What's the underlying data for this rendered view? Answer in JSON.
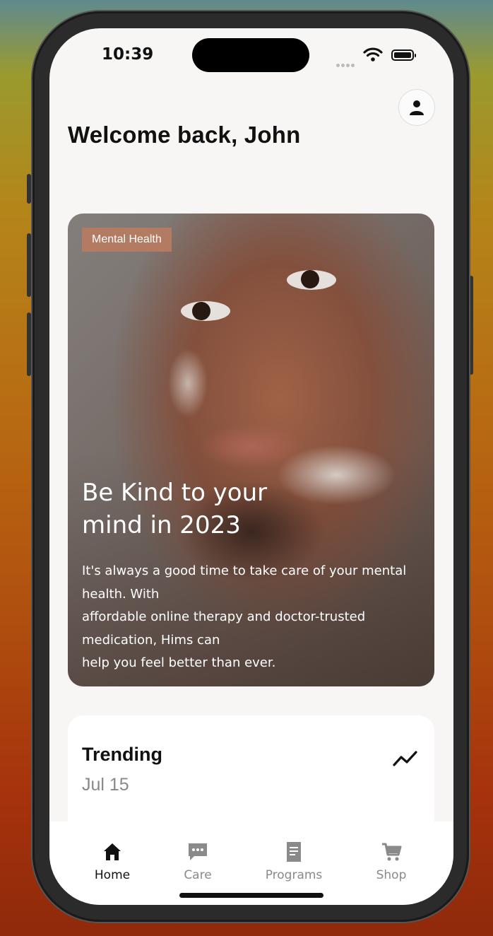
{
  "status_bar": {
    "time": "10:39"
  },
  "header": {
    "welcome": "Welcome back, John"
  },
  "hero": {
    "tag": "Mental Health",
    "title": "Be Kind to your\nmind in 2023",
    "body": "It's always a good time to take care of your mental\nhealth. With\n affordable online therapy and doctor-trusted\nmedication, Hims can\n help you feel better than ever."
  },
  "trending": {
    "title": "Trending",
    "date": "Jul 15"
  },
  "tabs": [
    {
      "label": "Home",
      "icon": "home-icon",
      "active": true
    },
    {
      "label": "Care",
      "icon": "chat-icon",
      "active": false
    },
    {
      "label": "Programs",
      "icon": "document-icon",
      "active": false
    },
    {
      "label": "Shop",
      "icon": "cart-icon",
      "active": false
    }
  ],
  "colors": {
    "tag_bg": "#b47b63",
    "active_tab": "#111111",
    "inactive_tab": "#8a8a8a"
  }
}
